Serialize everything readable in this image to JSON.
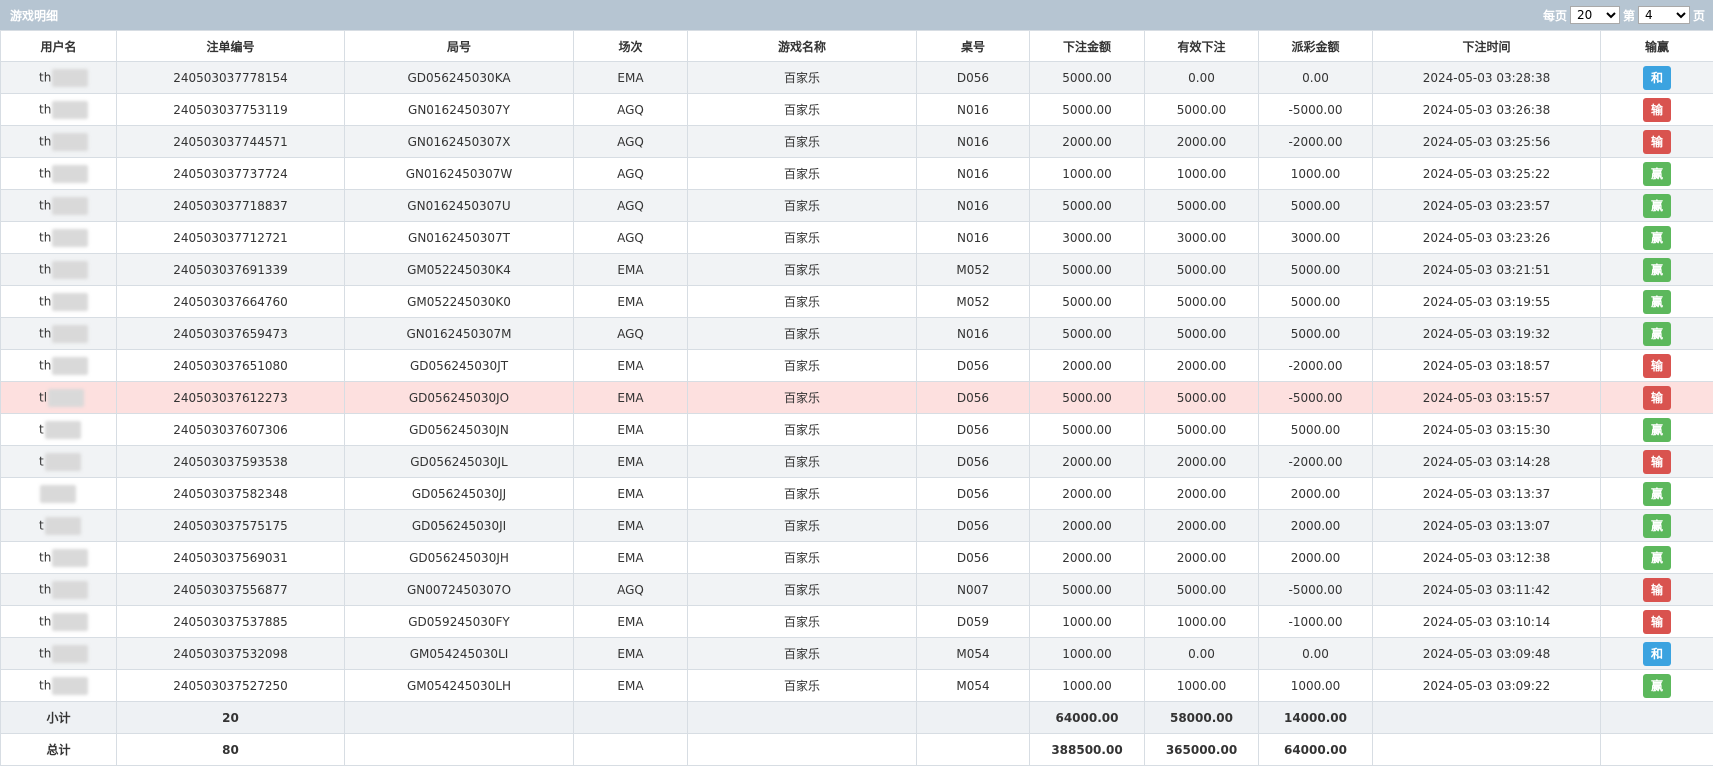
{
  "title": "游戏明细",
  "pager": {
    "per_page_label": "每页",
    "per_page_value": "20",
    "page_prefix": "第",
    "page_value": "4",
    "page_suffix": "页"
  },
  "colors": {
    "header_bar": "#b6c5d2",
    "tie": "#3ba3e0",
    "lose": "#d9534f",
    "win": "#5cb85c",
    "highlight_row": "#fde0df"
  },
  "columns": [
    "用户名",
    "注单编号",
    "局号",
    "场次",
    "游戏名称",
    "桌号",
    "下注金额",
    "有效下注",
    "派彩金额",
    "下注时间",
    "输赢"
  ],
  "rows": [
    {
      "user": "th",
      "bet_id": "240503037778154",
      "round": "GD056245030KA",
      "venue": "EMA",
      "game": "百家乐",
      "table": "D056",
      "bet": "5000.00",
      "valid": "0.00",
      "payout": "0.00",
      "time": "2024-05-03 03:28:38",
      "result": "和",
      "result_type": "tie"
    },
    {
      "user": "th",
      "bet_id": "240503037753119",
      "round": "GN0162450307Y",
      "venue": "AGQ",
      "game": "百家乐",
      "table": "N016",
      "bet": "5000.00",
      "valid": "5000.00",
      "payout": "-5000.00",
      "time": "2024-05-03 03:26:38",
      "result": "输",
      "result_type": "lose"
    },
    {
      "user": "th",
      "bet_id": "240503037744571",
      "round": "GN0162450307X",
      "venue": "AGQ",
      "game": "百家乐",
      "table": "N016",
      "bet": "2000.00",
      "valid": "2000.00",
      "payout": "-2000.00",
      "time": "2024-05-03 03:25:56",
      "result": "输",
      "result_type": "lose"
    },
    {
      "user": "th",
      "bet_id": "240503037737724",
      "round": "GN0162450307W",
      "venue": "AGQ",
      "game": "百家乐",
      "table": "N016",
      "bet": "1000.00",
      "valid": "1000.00",
      "payout": "1000.00",
      "time": "2024-05-03 03:25:22",
      "result": "赢",
      "result_type": "win"
    },
    {
      "user": "th",
      "bet_id": "240503037718837",
      "round": "GN0162450307U",
      "venue": "AGQ",
      "game": "百家乐",
      "table": "N016",
      "bet": "5000.00",
      "valid": "5000.00",
      "payout": "5000.00",
      "time": "2024-05-03 03:23:57",
      "result": "赢",
      "result_type": "win"
    },
    {
      "user": "th",
      "bet_id": "240503037712721",
      "round": "GN0162450307T",
      "venue": "AGQ",
      "game": "百家乐",
      "table": "N016",
      "bet": "3000.00",
      "valid": "3000.00",
      "payout": "3000.00",
      "time": "2024-05-03 03:23:26",
      "result": "赢",
      "result_type": "win"
    },
    {
      "user": "th",
      "bet_id": "240503037691339",
      "round": "GM052245030K4",
      "venue": "EMA",
      "game": "百家乐",
      "table": "M052",
      "bet": "5000.00",
      "valid": "5000.00",
      "payout": "5000.00",
      "time": "2024-05-03 03:21:51",
      "result": "赢",
      "result_type": "win"
    },
    {
      "user": "th",
      "bet_id": "240503037664760",
      "round": "GM052245030K0",
      "venue": "EMA",
      "game": "百家乐",
      "table": "M052",
      "bet": "5000.00",
      "valid": "5000.00",
      "payout": "5000.00",
      "time": "2024-05-03 03:19:55",
      "result": "赢",
      "result_type": "win"
    },
    {
      "user": "th",
      "bet_id": "240503037659473",
      "round": "GN0162450307M",
      "venue": "AGQ",
      "game": "百家乐",
      "table": "N016",
      "bet": "5000.00",
      "valid": "5000.00",
      "payout": "5000.00",
      "time": "2024-05-03 03:19:32",
      "result": "赢",
      "result_type": "win"
    },
    {
      "user": "th",
      "bet_id": "240503037651080",
      "round": "GD056245030JT",
      "venue": "EMA",
      "game": "百家乐",
      "table": "D056",
      "bet": "2000.00",
      "valid": "2000.00",
      "payout": "-2000.00",
      "time": "2024-05-03 03:18:57",
      "result": "输",
      "result_type": "lose"
    },
    {
      "user": "tl",
      "bet_id": "240503037612273",
      "round": "GD056245030JO",
      "venue": "EMA",
      "game": "百家乐",
      "table": "D056",
      "bet": "5000.00",
      "valid": "5000.00",
      "payout": "-5000.00",
      "time": "2024-05-03 03:15:57",
      "result": "输",
      "result_type": "lose",
      "highlight": true
    },
    {
      "user": "t",
      "bet_id": "240503037607306",
      "round": "GD056245030JN",
      "venue": "EMA",
      "game": "百家乐",
      "table": "D056",
      "bet": "5000.00",
      "valid": "5000.00",
      "payout": "5000.00",
      "time": "2024-05-03 03:15:30",
      "result": "赢",
      "result_type": "win"
    },
    {
      "user": "t",
      "bet_id": "240503037593538",
      "round": "GD056245030JL",
      "venue": "EMA",
      "game": "百家乐",
      "table": "D056",
      "bet": "2000.00",
      "valid": "2000.00",
      "payout": "-2000.00",
      "time": "2024-05-03 03:14:28",
      "result": "输",
      "result_type": "lose"
    },
    {
      "user": "",
      "bet_id": "240503037582348",
      "round": "GD056245030JJ",
      "venue": "EMA",
      "game": "百家乐",
      "table": "D056",
      "bet": "2000.00",
      "valid": "2000.00",
      "payout": "2000.00",
      "time": "2024-05-03 03:13:37",
      "result": "赢",
      "result_type": "win"
    },
    {
      "user": "t",
      "bet_id": "240503037575175",
      "round": "GD056245030JI",
      "venue": "EMA",
      "game": "百家乐",
      "table": "D056",
      "bet": "2000.00",
      "valid": "2000.00",
      "payout": "2000.00",
      "time": "2024-05-03 03:13:07",
      "result": "赢",
      "result_type": "win"
    },
    {
      "user": "th",
      "bet_id": "240503037569031",
      "round": "GD056245030JH",
      "venue": "EMA",
      "game": "百家乐",
      "table": "D056",
      "bet": "2000.00",
      "valid": "2000.00",
      "payout": "2000.00",
      "time": "2024-05-03 03:12:38",
      "result": "赢",
      "result_type": "win"
    },
    {
      "user": "th",
      "bet_id": "240503037556877",
      "round": "GN0072450307O",
      "venue": "AGQ",
      "game": "百家乐",
      "table": "N007",
      "bet": "5000.00",
      "valid": "5000.00",
      "payout": "-5000.00",
      "time": "2024-05-03 03:11:42",
      "result": "输",
      "result_type": "lose"
    },
    {
      "user": "th",
      "bet_id": "240503037537885",
      "round": "GD059245030FY",
      "venue": "EMA",
      "game": "百家乐",
      "table": "D059",
      "bet": "1000.00",
      "valid": "1000.00",
      "payout": "-1000.00",
      "time": "2024-05-03 03:10:14",
      "result": "输",
      "result_type": "lose"
    },
    {
      "user": "th",
      "bet_id": "240503037532098",
      "round": "GM054245030LI",
      "venue": "EMA",
      "game": "百家乐",
      "table": "M054",
      "bet": "1000.00",
      "valid": "0.00",
      "payout": "0.00",
      "time": "2024-05-03 03:09:48",
      "result": "和",
      "result_type": "tie"
    },
    {
      "user": "th",
      "bet_id": "240503037527250",
      "round": "GM054245030LH",
      "venue": "EMA",
      "game": "百家乐",
      "table": "M054",
      "bet": "1000.00",
      "valid": "1000.00",
      "payout": "1000.00",
      "time": "2024-05-03 03:09:22",
      "result": "赢",
      "result_type": "win"
    }
  ],
  "subtotal": {
    "label": "小计",
    "count": "20",
    "bet": "64000.00",
    "valid": "58000.00",
    "payout": "14000.00"
  },
  "total": {
    "label": "总计",
    "count": "80",
    "bet": "388500.00",
    "valid": "365000.00",
    "payout": "64000.00"
  }
}
